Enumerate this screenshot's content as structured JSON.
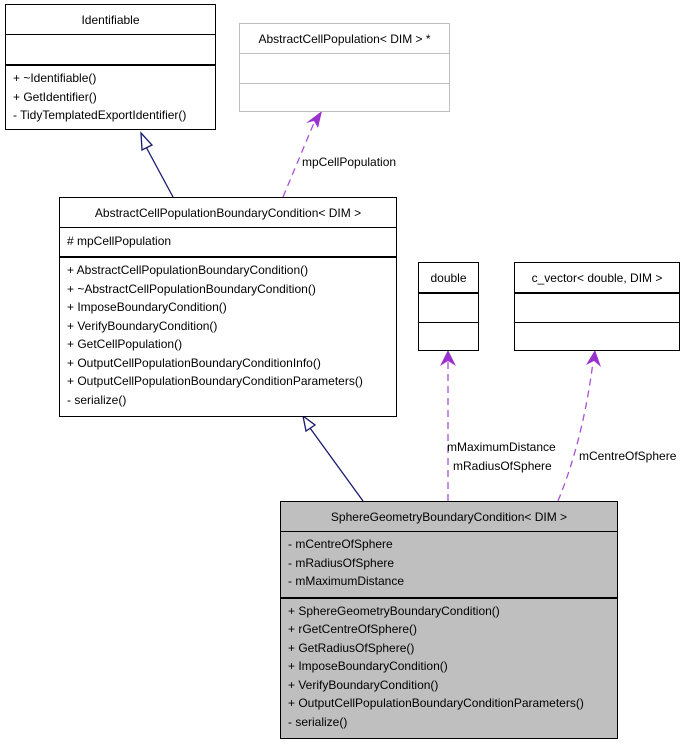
{
  "diagram": {
    "type": "uml-collaboration",
    "colors": {
      "inheritance_edge": "#191970",
      "usage_edge": "#9a32cd",
      "focus_fill": "#bfbfbf",
      "external_border": "#bfbfbf"
    },
    "classes": {
      "identifiable": {
        "name": "Identifiable",
        "attributes": [],
        "methods": [
          "+ ~Identifiable()",
          "+ GetIdentifier()",
          "- TidyTemplatedExportIdentifier()"
        ]
      },
      "abstract_cell_population_ptr": {
        "name": "AbstractCellPopulation< DIM > *",
        "attributes": [],
        "methods": []
      },
      "abstract_boundary_condition": {
        "name": "AbstractCellPopulationBoundaryCondition< DIM >",
        "attributes": [
          "# mpCellPopulation"
        ],
        "methods": [
          "+ AbstractCellPopulationBoundaryCondition()",
          "+ ~AbstractCellPopulationBoundaryCondition()",
          "+ ImposeBoundaryCondition()",
          "+ VerifyBoundaryCondition()",
          "+ GetCellPopulation()",
          "+ OutputCellPopulationBoundaryConditionInfo()",
          "+ OutputCellPopulationBoundaryConditionParameters()",
          "- serialize()"
        ]
      },
      "double": {
        "name": "double",
        "attributes": [],
        "methods": []
      },
      "c_vector": {
        "name": "c_vector< double, DIM >",
        "attributes": [],
        "methods": []
      },
      "sphere_geometry": {
        "name": "SphereGeometryBoundaryCondition< DIM >",
        "attributes": [
          "- mCentreOfSphere",
          "- mRadiusOfSphere",
          "- mMaximumDistance"
        ],
        "methods": [
          "+ SphereGeometryBoundaryCondition()",
          "+ rGetCentreOfSphere()",
          "+ GetRadiusOfSphere()",
          "+ ImposeBoundaryCondition()",
          "+ VerifyBoundaryCondition()",
          "+ OutputCellPopulationBoundaryConditionParameters()",
          "- serialize()"
        ]
      }
    },
    "edge_labels": {
      "mp_cell_population": "mpCellPopulation",
      "m_maximum_distance": "mMaximumDistance",
      "m_radius_of_sphere": "mRadiusOfSphere",
      "m_centre_of_sphere": "mCentreOfSphere"
    }
  }
}
